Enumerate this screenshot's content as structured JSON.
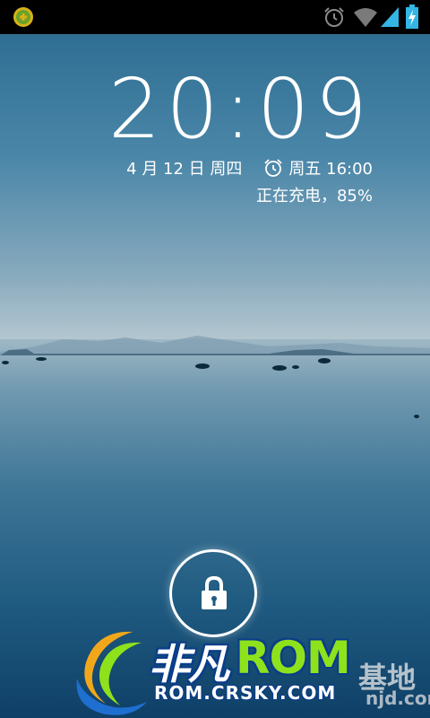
{
  "status_bar": {
    "icons": [
      "notification-app-icon",
      "alarm-icon",
      "wifi-icon",
      "signal-icon",
      "battery-charging-icon"
    ]
  },
  "lockscreen": {
    "time": "20:09",
    "date": "4 月 12 日 周四",
    "next_alarm": "周五 16:00",
    "charging_status": "正在充电，85%",
    "unlock_icon": "lock-icon"
  },
  "watermark": {
    "brand_cn": "非凡",
    "brand_rom": "ROM",
    "suffix_cn": "基地",
    "url": "ROM.CRSKY.COM",
    "url_tail": "njd.com"
  },
  "colors": {
    "status_bar_bg": "#000000",
    "status_icon": "#33b5e5",
    "logo_green": "#8ee21b",
    "logo_blue": "#0a3d8a"
  }
}
